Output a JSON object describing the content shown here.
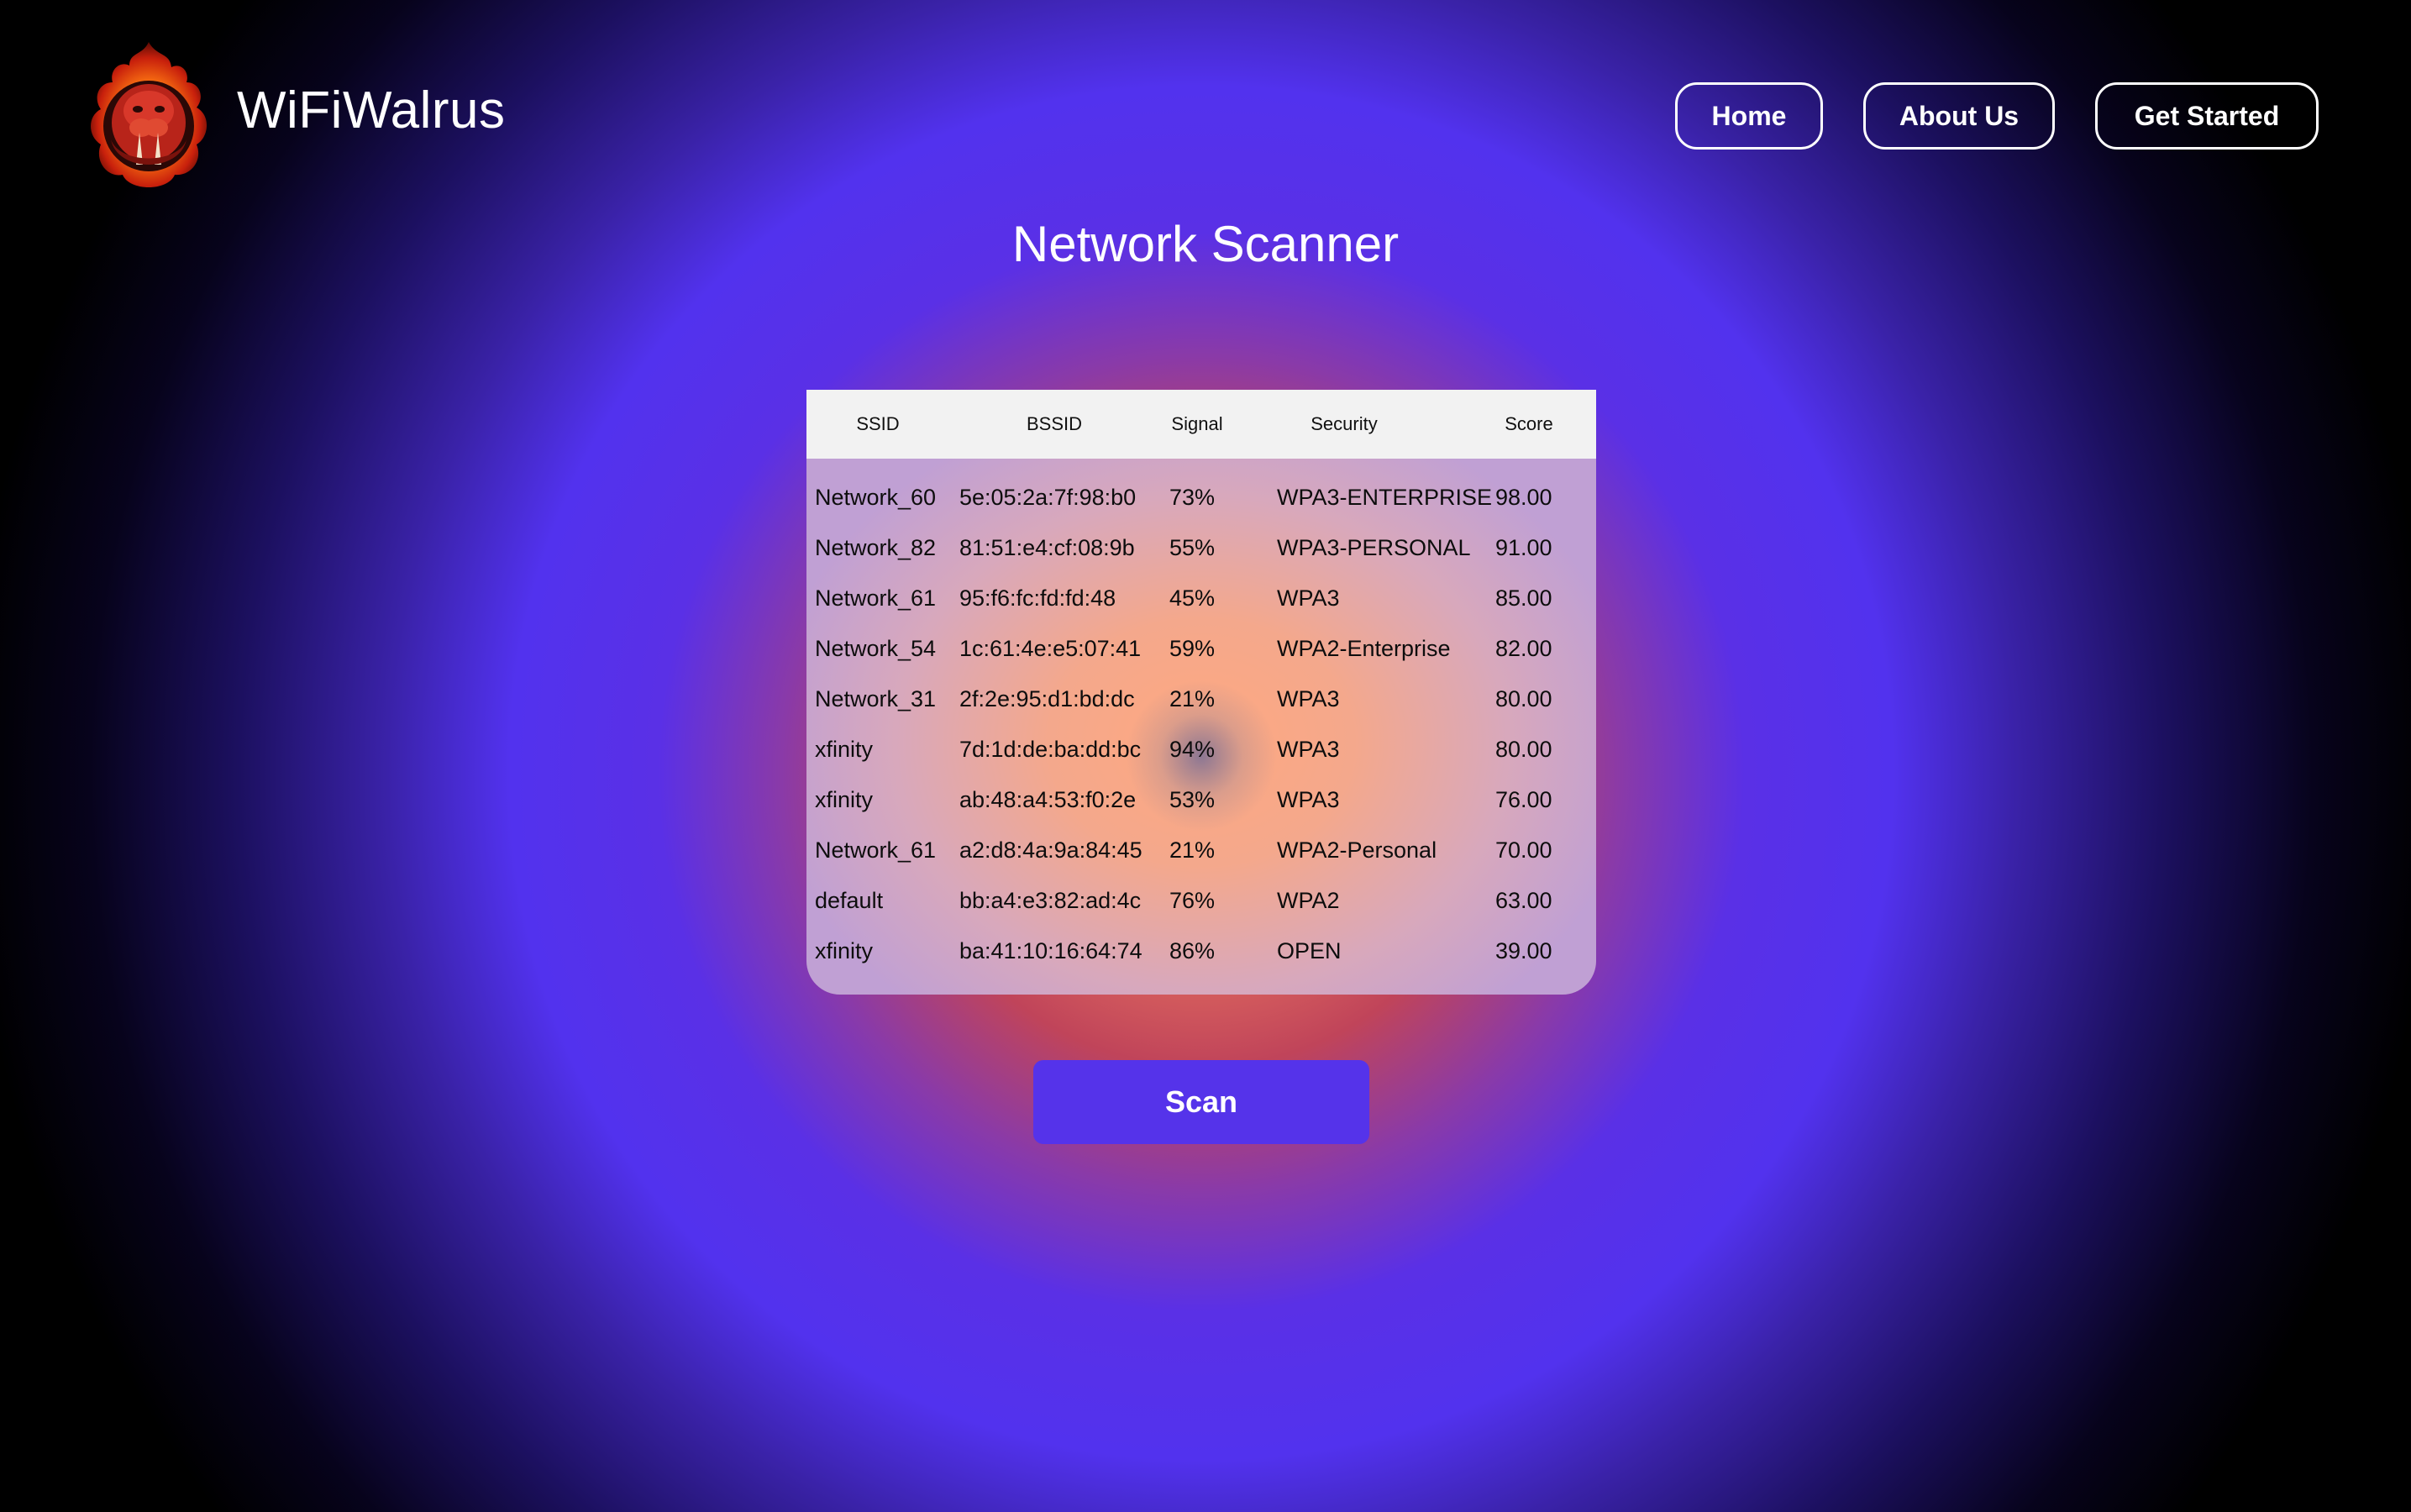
{
  "header": {
    "brand": "WiFiWalrus",
    "logo_icon": "walrus-flame-logo",
    "nav": [
      {
        "label": "Home"
      },
      {
        "label": "About Us"
      },
      {
        "label": "Get Started"
      }
    ]
  },
  "main": {
    "title": "Network Scanner",
    "table": {
      "columns": [
        "SSID",
        "BSSID",
        "Signal",
        "Security",
        "Score"
      ],
      "rows": [
        {
          "ssid": "Network_60",
          "bssid": "5e:05:2a:7f:98:b0",
          "signal": "73%",
          "security": "WPA3-ENTERPRISE",
          "score": "98.00"
        },
        {
          "ssid": "Network_82",
          "bssid": "81:51:e4:cf:08:9b",
          "signal": "55%",
          "security": "WPA3-PERSONAL",
          "score": "91.00"
        },
        {
          "ssid": "Network_61",
          "bssid": "95:f6:fc:fd:fd:48",
          "signal": "45%",
          "security": "WPA3",
          "score": "85.00"
        },
        {
          "ssid": "Network_54",
          "bssid": "1c:61:4e:e5:07:41",
          "signal": "59%",
          "security": "WPA2-Enterprise",
          "score": "82.00"
        },
        {
          "ssid": "Network_31",
          "bssid": "2f:2e:95:d1:bd:dc",
          "signal": "21%",
          "security": "WPA3",
          "score": "80.00"
        },
        {
          "ssid": "xfinity",
          "bssid": "7d:1d:de:ba:dd:bc",
          "signal": "94%",
          "security": "WPA3",
          "score": "80.00"
        },
        {
          "ssid": "xfinity",
          "bssid": "ab:48:a4:53:f0:2e",
          "signal": "53%",
          "security": "WPA3",
          "score": "76.00"
        },
        {
          "ssid": "Network_61",
          "bssid": "a2:d8:4a:9a:84:45",
          "signal": "21%",
          "security": "WPA2-Personal",
          "score": "70.00"
        },
        {
          "ssid": "default",
          "bssid": "bb:a4:e3:82:ad:4c",
          "signal": "76%",
          "security": "WPA2",
          "score": "63.00"
        },
        {
          "ssid": "xfinity",
          "bssid": "ba:41:10:16:64:74",
          "signal": "86%",
          "security": "OPEN",
          "score": "39.00"
        }
      ]
    },
    "scan_label": "Scan"
  },
  "colors": {
    "accent": "#5533ea",
    "glow_center": "#ff9f80",
    "glow_ring": "#5232ee",
    "background_edge": "#000000"
  }
}
